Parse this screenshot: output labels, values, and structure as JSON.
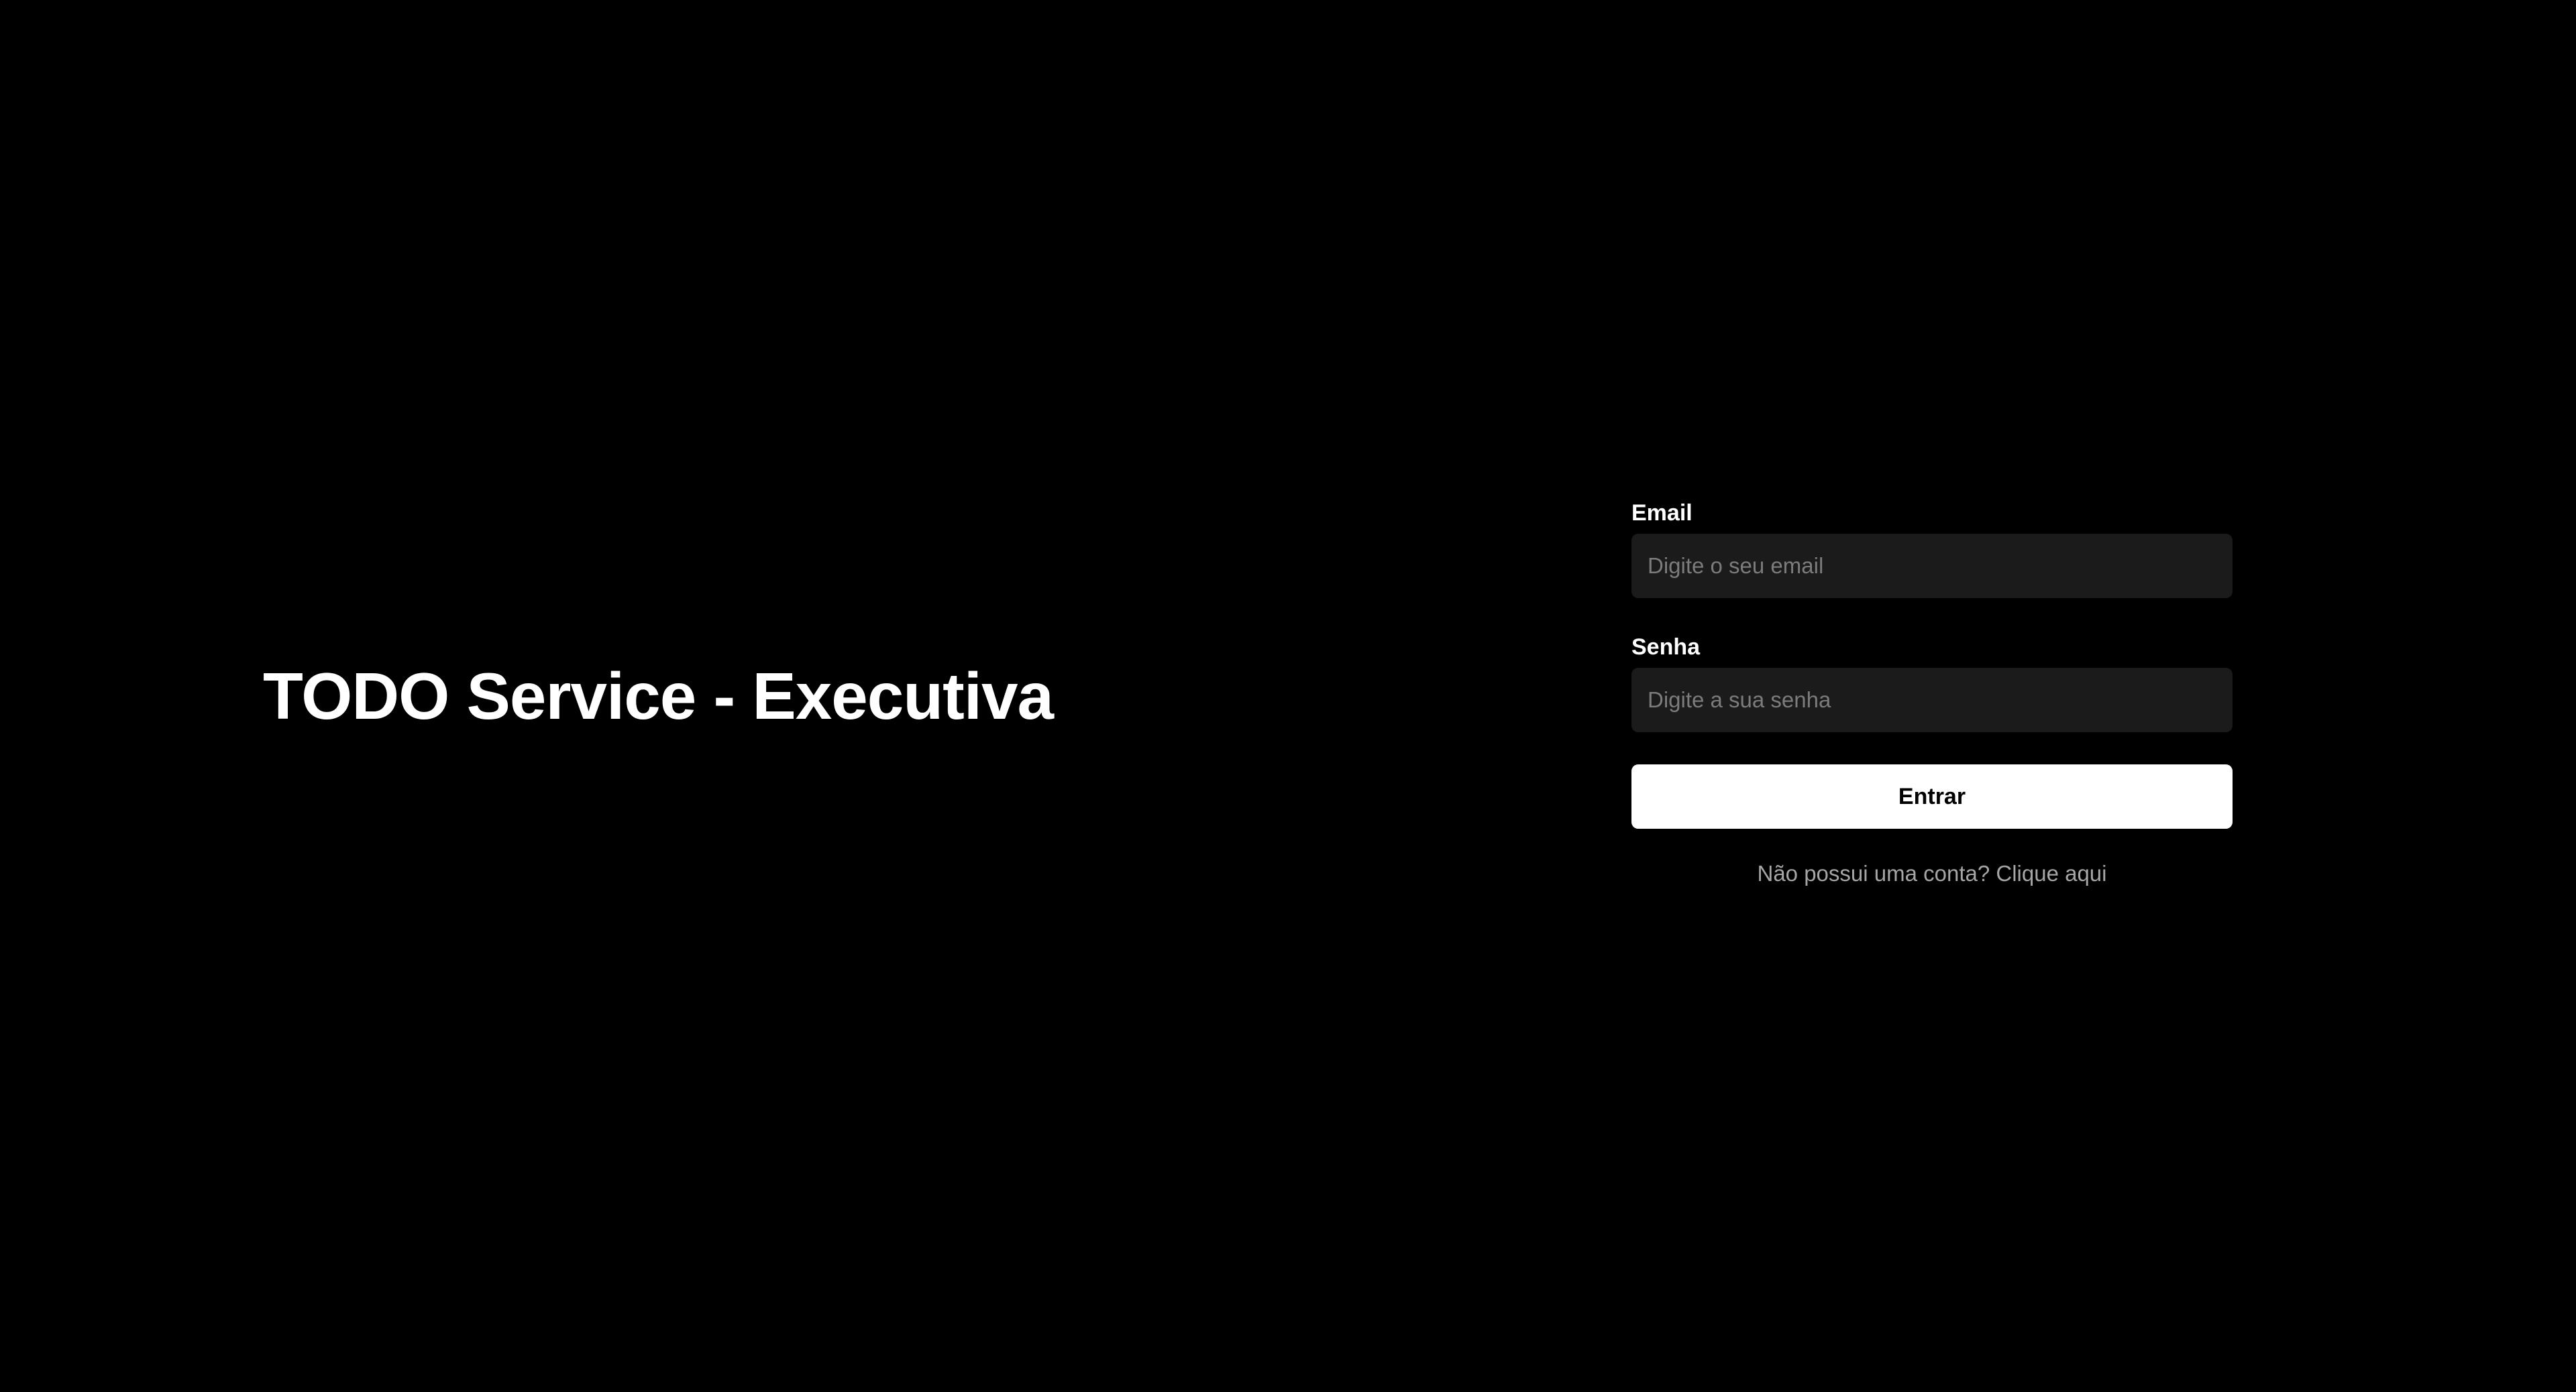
{
  "brand": {
    "title": "TODO Service - Executiva"
  },
  "login_form": {
    "email": {
      "label": "Email",
      "value": "",
      "placeholder": "Digite o seu email"
    },
    "password": {
      "label": "Senha",
      "value": "",
      "placeholder": "Digite a sua senha"
    },
    "submit_label": "Entrar",
    "signup_link_text": "Não possui uma conta? Clique aqui"
  },
  "colors": {
    "background": "#000000",
    "text_primary": "#ffffff",
    "input_background": "#1b1b1b",
    "placeholder": "#7c7c7c",
    "button_background": "#ffffff",
    "button_text": "#000000",
    "link_text": "#a6a6a6"
  }
}
